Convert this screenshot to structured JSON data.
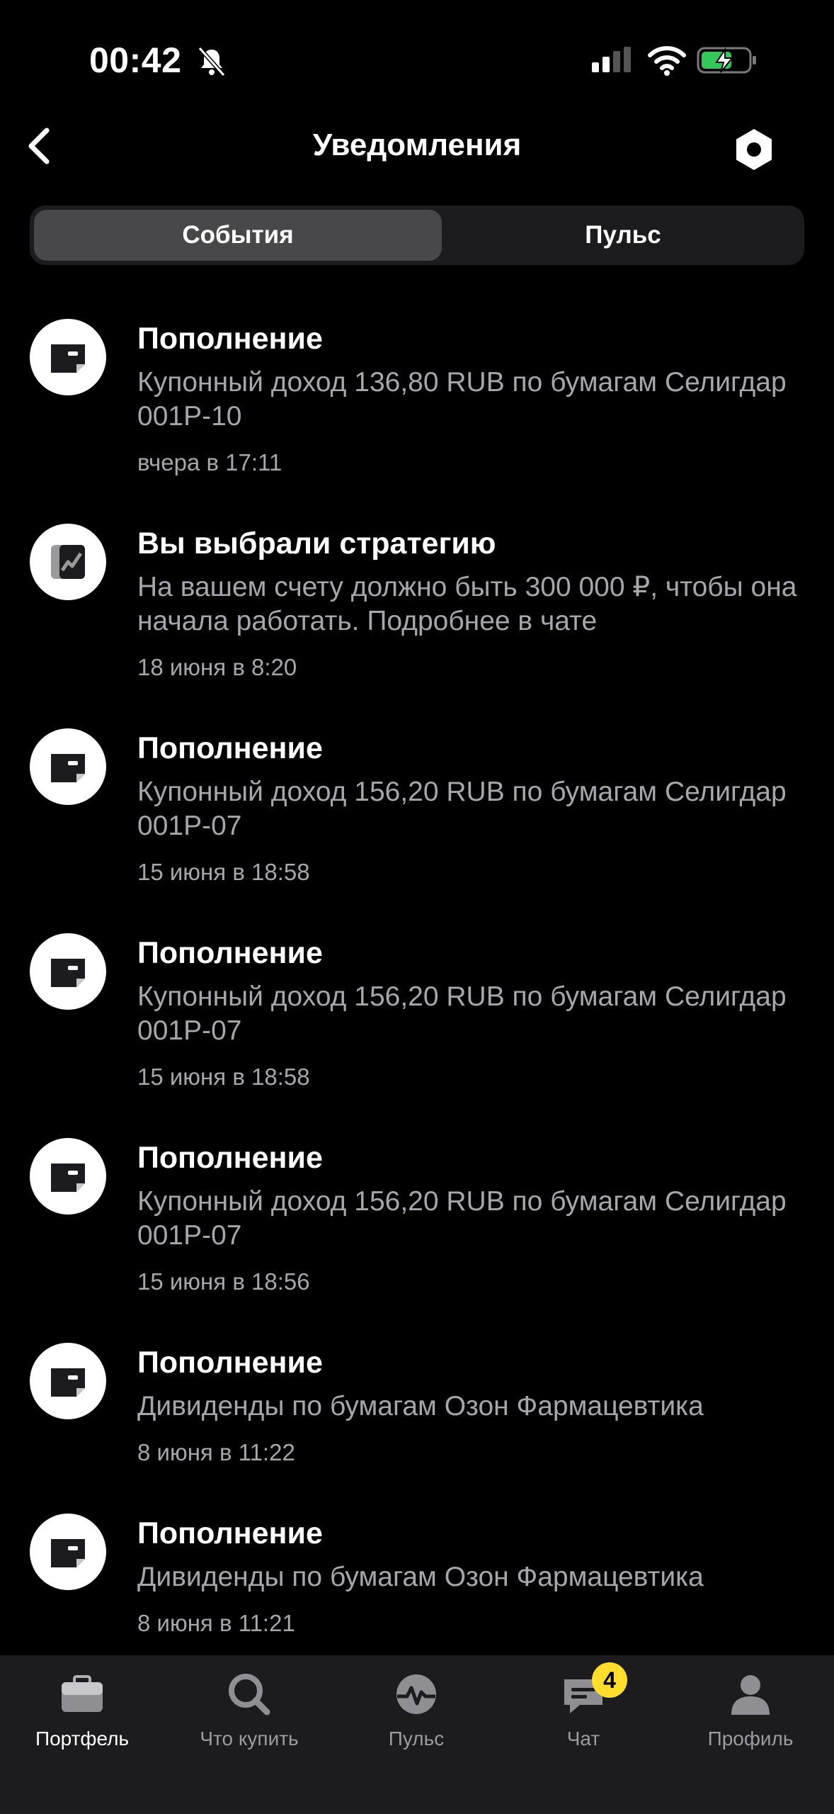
{
  "status_bar": {
    "time": "00:42"
  },
  "header": {
    "title": "Уведомления"
  },
  "tabs": [
    {
      "label": "События",
      "active": true
    },
    {
      "label": "Пульс",
      "active": false
    }
  ],
  "notifications": [
    {
      "icon": "wallet-icon",
      "title": "Пополнение",
      "body": "Купонный доход 136,80 RUB по бумагам Селигдар 001P-10",
      "time": "вчера в 17:11"
    },
    {
      "icon": "strategy-icon",
      "title": "Вы выбрали стратегию",
      "body": "На вашем счету должно быть 300 000 ₽, чтобы она начала работать. Подробнее в чате",
      "time": "18 июня в 8:20"
    },
    {
      "icon": "wallet-icon",
      "title": "Пополнение",
      "body": "Купонный доход 156,20 RUB по бумагам Селигдар 001P-07",
      "time": "15 июня в 18:58"
    },
    {
      "icon": "wallet-icon",
      "title": "Пополнение",
      "body": "Купонный доход 156,20 RUB по бумагам Селигдар 001P-07",
      "time": "15 июня в 18:58"
    },
    {
      "icon": "wallet-icon",
      "title": "Пополнение",
      "body": "Купонный доход 156,20 RUB по бумагам Селигдар 001P-07",
      "time": "15 июня в 18:56"
    },
    {
      "icon": "wallet-icon",
      "title": "Пополнение",
      "body": "Дивиденды по бумагам Озон Фармацевтика",
      "time": "8 июня в 11:22"
    },
    {
      "icon": "wallet-icon",
      "title": "Пополнение",
      "body": "Дивиденды по бумагам Озон Фармацевтика",
      "time": "8 июня в 11:21"
    }
  ],
  "tabbar": [
    {
      "label": "Портфель",
      "icon": "briefcase-icon",
      "active": true
    },
    {
      "label": "Что купить",
      "icon": "search-icon",
      "active": false
    },
    {
      "label": "Пульс",
      "icon": "pulse-icon",
      "active": false
    },
    {
      "label": "Чат",
      "icon": "chat-icon",
      "active": false,
      "badge": "4"
    },
    {
      "label": "Профиль",
      "icon": "profile-icon",
      "active": false
    }
  ],
  "colors": {
    "background": "#000000",
    "surface": "#1c1c1e",
    "segment_active": "#48484a",
    "secondary_text": "#a6a6ab",
    "badge": "#ffdd2d"
  }
}
